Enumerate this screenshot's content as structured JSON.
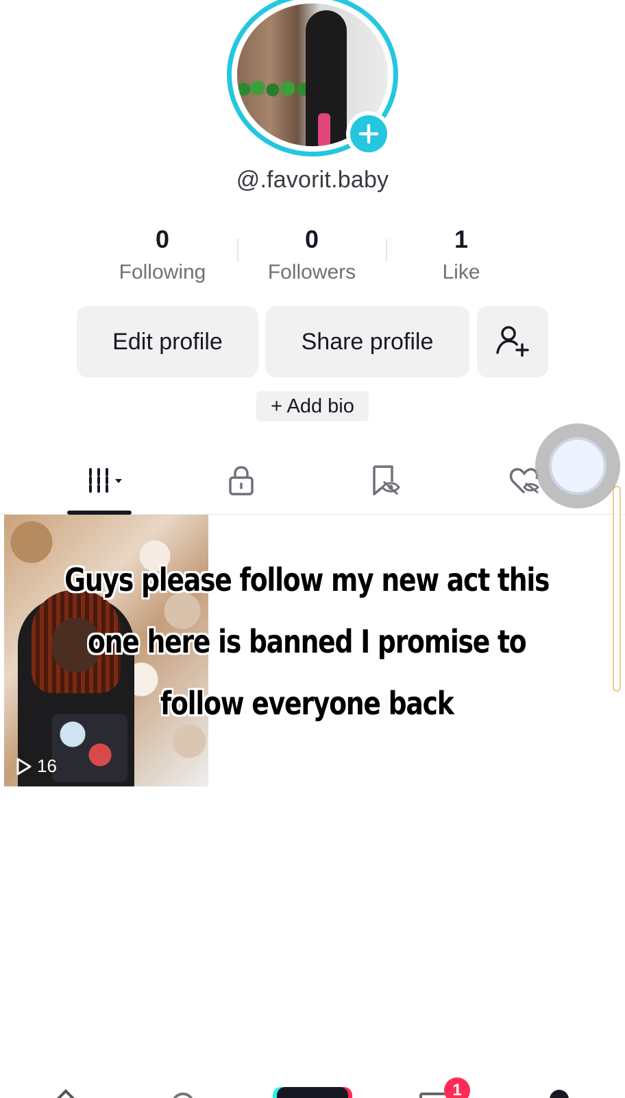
{
  "profile": {
    "username": "@.favorit.baby",
    "stats": [
      {
        "value": "0",
        "label": "Following"
      },
      {
        "value": "0",
        "label": "Followers"
      },
      {
        "value": "1",
        "label": "Like"
      }
    ]
  },
  "actions": {
    "edit_label": "Edit profile",
    "share_label": "Share profile",
    "add_bio_label": "+ Add bio"
  },
  "tabs": [
    {
      "name": "videos",
      "icon": "grid-icon",
      "active": true
    },
    {
      "name": "private",
      "icon": "lock-icon",
      "active": false
    },
    {
      "name": "reposts",
      "icon": "bookmark-hidden-icon",
      "active": false
    },
    {
      "name": "liked",
      "icon": "heart-hidden-icon",
      "active": false
    }
  ],
  "videos": [
    {
      "play_count": "16"
    }
  ],
  "caption": {
    "line1": "Guys please follow my new act this",
    "line2": "one here is banned I promise to",
    "line3": "follow everyone back"
  },
  "bottom_nav": {
    "inbox_badge": "1"
  },
  "colors": {
    "accent_cyan": "#25c6e0",
    "brand_red": "#fe2c55",
    "button_gray": "#f1f1f2"
  }
}
